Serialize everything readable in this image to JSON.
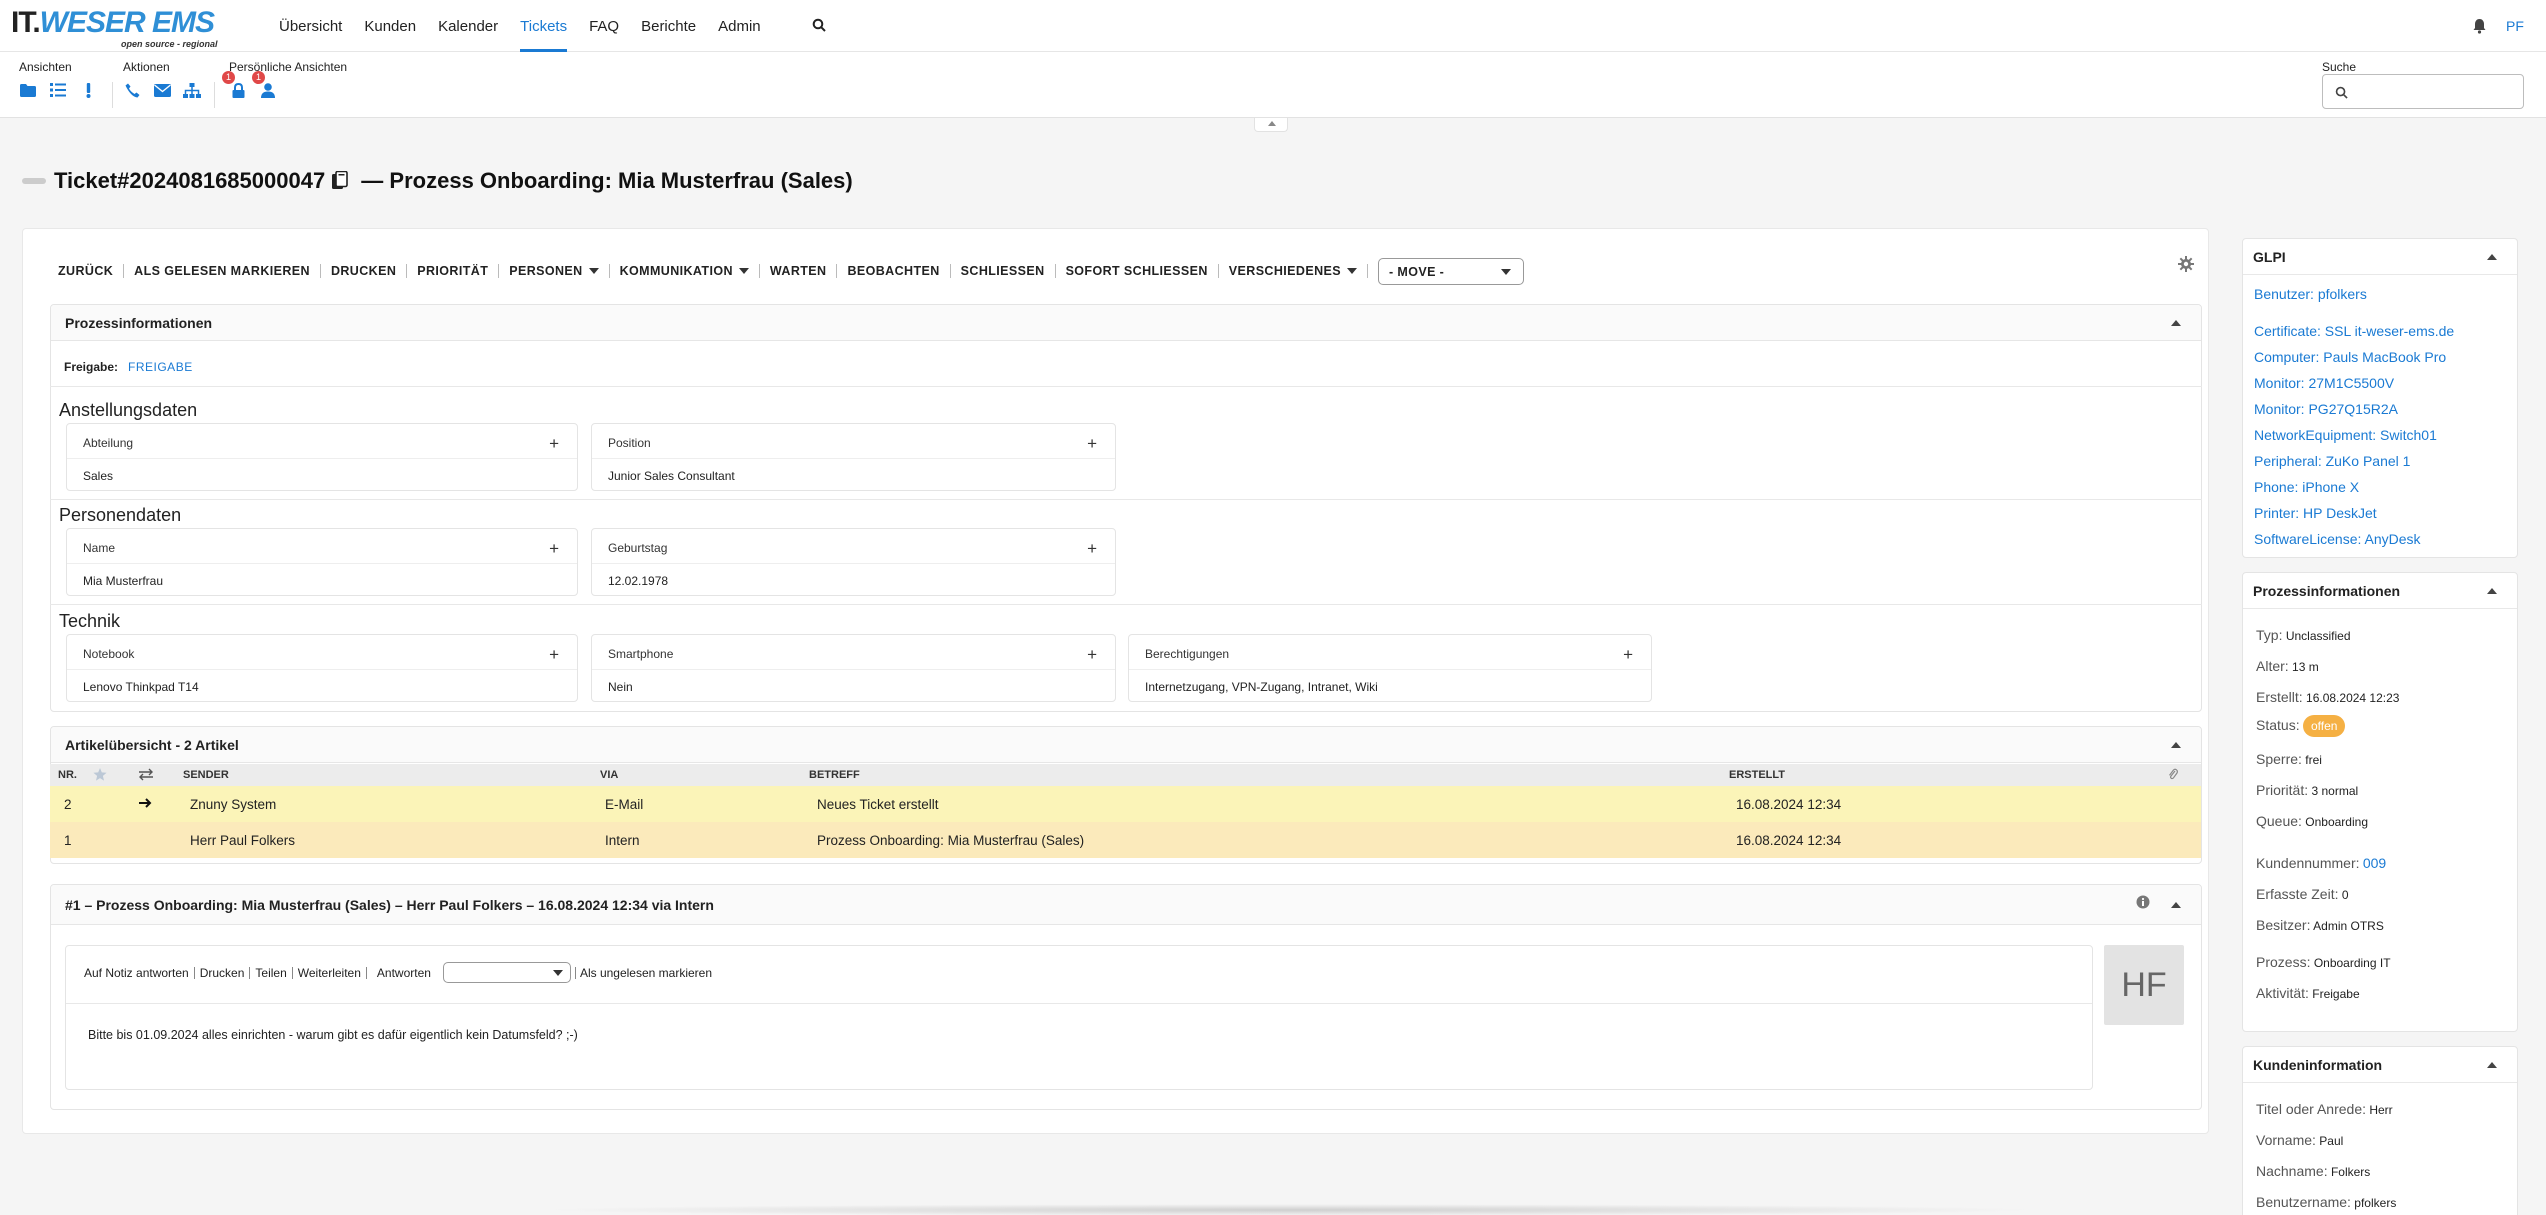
{
  "brand": {
    "logo_left": "IT.",
    "logo_right": "WESER EMS",
    "tagline": "open source - regional"
  },
  "nav": {
    "items": [
      "Übersicht",
      "Kunden",
      "Kalender",
      "Tickets",
      "FAQ",
      "Berichte",
      "Admin"
    ],
    "active": "Tickets",
    "user": "PF"
  },
  "toolbar": {
    "views_label": "Ansichten",
    "actions_label": "Aktionen",
    "personal_label": "Persönliche Ansichten",
    "lock_badge": "1",
    "user_badge": "1",
    "search_label": "Suche"
  },
  "ticket": {
    "title_prefix": "Ticket#2024081685000047",
    "title_sep": " — ",
    "title_text": "Prozess Onboarding: Mia Musterfrau (Sales)"
  },
  "actions": {
    "items": [
      "ZURÜCK",
      "ALS GELESEN MARKIEREN",
      "DRUCKEN",
      "PRIORITÄT",
      "PERSONEN",
      "KOMMUNIKATION",
      "WARTEN",
      "BEOBACHTEN",
      "SCHLIESSEN",
      "SOFORT SCHLIESSEN",
      "VERSCHIEDENES"
    ],
    "move": "- MOVE -"
  },
  "process": {
    "header": "Prozessinformationen",
    "freigabe_key": "Freigabe:",
    "freigabe_val": "FREIGABE",
    "sections": [
      {
        "title": "Anstellungsdaten",
        "fields": [
          {
            "label": "Abteilung",
            "value": "Sales"
          },
          {
            "label": "Position",
            "value": "Junior Sales Consultant"
          }
        ]
      },
      {
        "title": "Personendaten",
        "fields": [
          {
            "label": "Name",
            "value": "Mia Musterfrau"
          },
          {
            "label": "Geburtstag",
            "value": "12.02.1978"
          }
        ]
      },
      {
        "title": "Technik",
        "fields": [
          {
            "label": "Notebook",
            "value": "Lenovo Thinkpad T14"
          },
          {
            "label": "Smartphone",
            "value": "Nein"
          },
          {
            "label": "Berechtigungen",
            "value": "Internetzugang, VPN-Zugang, Intranet, Wiki"
          }
        ]
      }
    ]
  },
  "articles": {
    "header": "Artikelübersicht - 2 Artikel",
    "cols": {
      "nr": "NR.",
      "sender": "SENDER",
      "via": "VIA",
      "betreff": "BETREFF",
      "erstellt": "ERSTELLT"
    },
    "rows": [
      {
        "nr": "2",
        "sender": "Znuny System",
        "via": "E-Mail",
        "betreff": "Neues Ticket erstellt",
        "erstellt": "16.08.2024 12:34"
      },
      {
        "nr": "1",
        "sender": "Herr Paul Folkers",
        "via": "Intern",
        "betreff": "Prozess Onboarding: Mia Musterfrau (Sales)",
        "erstellt": "16.08.2024 12:34"
      }
    ]
  },
  "article": {
    "header": "#1 – Prozess Onboarding: Mia Musterfrau (Sales) – Herr Paul Folkers – 16.08.2024 12:34 via Intern",
    "tools": [
      "Auf Notiz antworten",
      "Drucken",
      "Teilen",
      "Weiterleiten"
    ],
    "reply_label": "Antworten",
    "mark_unread": "Als ungelesen markieren",
    "body": "Bitte bis 01.09.2024 alles einrichten - warum gibt es dafür eigentlich kein Datumsfeld? ;-)",
    "avatar": "HF"
  },
  "glpi": {
    "header": "GLPI",
    "links": [
      "Benutzer: pfolkers",
      "Certificate: SSL it-weser-ems.de",
      "Computer: Pauls MacBook Pro",
      "Monitor: 27M1C5500V",
      "Monitor: PG27Q15R2A",
      "NetworkEquipment: Switch01",
      "Peripheral: ZuKo Panel 1",
      "Phone: iPhone X",
      "Printer: HP DeskJet",
      "SoftwareLicense: AnyDesk"
    ]
  },
  "procinfo": {
    "header": "Prozessinformationen",
    "typ_k": "Typ:",
    "typ_v": "Unclassified",
    "alter_k": "Alter:",
    "alter_v": "13 m",
    "erstellt_k": "Erstellt:",
    "erstellt_v": "16.08.2024 12:23",
    "status_k": "Status:",
    "status_v": "offen",
    "sperre_k": "Sperre:",
    "sperre_v": "frei",
    "prio_k": "Priorität:",
    "prio_v": "3 normal",
    "queue_k": "Queue:",
    "queue_v": "Onboarding",
    "kundennr_k": "Kundennummer:",
    "kundennr_v": "009",
    "zeit_k": "Erfasste Zeit:",
    "zeit_v": "0",
    "besitzer_k": "Besitzer:",
    "besitzer_v": "Admin OTRS",
    "prozess_k": "Prozess:",
    "prozess_v": "Onboarding IT",
    "aktivitaet_k": "Aktivität:",
    "aktivitaet_v": "Freigabe",
    "status_color": "#f5b043"
  },
  "customer": {
    "header": "Kundeninformation",
    "titel_k": "Titel oder Anrede:",
    "titel_v": "Herr",
    "vorname_k": "Vorname:",
    "vorname_v": "Paul",
    "nachname_k": "Nachname:",
    "nachname_v": "Folkers",
    "benutzer_k": "Benutzername:",
    "benutzer_v": "pfolkers"
  }
}
